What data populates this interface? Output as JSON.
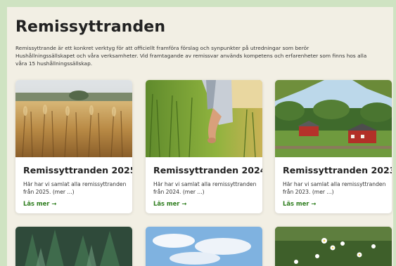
{
  "page": {
    "title": "Remissyttranden",
    "intro": "Remissyttrande är ett konkret verktyg för att officiellt framföra förslag och synpunkter på utredningar som berör Hushållningssällskapet och våra verksamheter. Vid framtagande av remissvar används kompetens och erfarenheter som finns hos alla våra 15 hushållningssällskap."
  },
  "cards": [
    {
      "title": "Remissyttranden 2025",
      "text": "Här har vi samlat alla remissyttranden från 2025. (mer ...)",
      "link": "Läs mer →",
      "image": "wheat-field-photo"
    },
    {
      "title": "Remissyttranden 2024",
      "text": "Här har vi samlat alla remissyttranden från 2024. (mer ...)",
      "link": "Läs mer →",
      "image": "hand-in-grain-photo"
    },
    {
      "title": "Remissyttranden 2023",
      "text": "Här har vi samlat alla remissyttranden från 2023. (mer ...)",
      "link": "Läs mer →",
      "image": "red-farmhouses-photo"
    }
  ],
  "more_cards": [
    {
      "image": "conifer-forest-photo"
    },
    {
      "image": "blue-sky-photo"
    },
    {
      "image": "wildflower-meadow-photo"
    }
  ],
  "colors": {
    "frame": "#cfe3c2",
    "background": "#f2efe4",
    "link": "#2e7d1e"
  }
}
